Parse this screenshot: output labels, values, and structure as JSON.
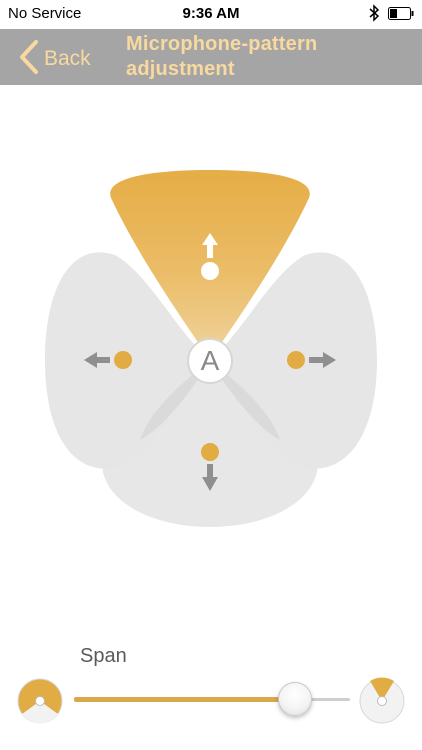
{
  "status_bar": {
    "carrier": "No Service",
    "time": "9:36 AM"
  },
  "nav": {
    "back_label": "Back",
    "title_line1": "Microphone-pattern",
    "title_line2": "adjustment"
  },
  "pattern": {
    "center_mode": "A",
    "directions": [
      "front",
      "left",
      "right",
      "back"
    ],
    "active_direction": "front"
  },
  "span": {
    "label": "Span",
    "value": 0.8
  },
  "colors": {
    "accent": "#e2ac45",
    "nav_bar": "#a5a5a5",
    "nav_text": "#f8d9a0",
    "lobe": "#e6e6e6",
    "arrow": "#8f8f8f"
  },
  "icons": [
    "chevron-left-icon",
    "bluetooth-icon",
    "battery-icon",
    "arrow-up-icon",
    "arrow-left-icon",
    "arrow-right-icon",
    "arrow-down-icon",
    "narrow-span-icon",
    "wide-span-icon"
  ]
}
